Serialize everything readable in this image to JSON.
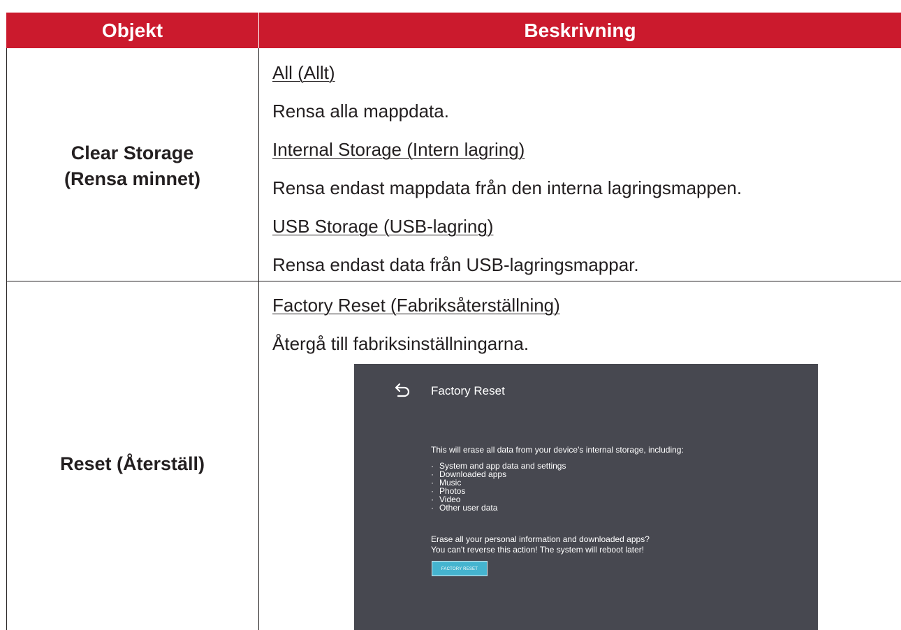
{
  "table": {
    "header": {
      "object": "Objekt",
      "description": "Beskrivning"
    },
    "rows": [
      {
        "object_line1": "Clear Storage",
        "object_line2": "(Rensa minnet)",
        "descriptions": [
          {
            "text": "All (Allt)",
            "underlined": true
          },
          {
            "text": "Rensa alla mappdata.",
            "underlined": false
          },
          {
            "text": "Internal Storage (Intern lagring)",
            "underlined": true
          },
          {
            "text": "Rensa endast mappdata från den interna lagringsmappen.",
            "underlined": false
          },
          {
            "text": "USB Storage (USB-lagring)",
            "underlined": true
          },
          {
            "text": "Rensa endast data från USB-lagringsmappar.",
            "underlined": false
          }
        ]
      },
      {
        "object_line1": "Reset (Återställ)",
        "descriptions": [
          {
            "text": "Factory Reset (Fabriksåterställning)",
            "underlined": true
          },
          {
            "text": "Återgå till fabriksinställningarna.",
            "underlined": false
          }
        ]
      }
    ]
  },
  "factory_reset_screen": {
    "back_icon": "back-arrow-icon",
    "title": "Factory Reset",
    "intro": "This will erase all data from your device's internal storage, including:",
    "bullet": "·",
    "items": [
      "System and app data and settings",
      "Downloaded apps",
      "Music",
      "Photos",
      "Video",
      "Other user data"
    ],
    "question": "Erase all your personal information and downloaded apps?",
    "warning": "You can't reverse this action! The system will reboot later!",
    "button_label": "FACTORY RESET"
  },
  "colors": {
    "header_bg": "#cb1a2d",
    "screen_bg": "#474850",
    "button_bg": "#45b4cf",
    "text": "#231f20"
  }
}
